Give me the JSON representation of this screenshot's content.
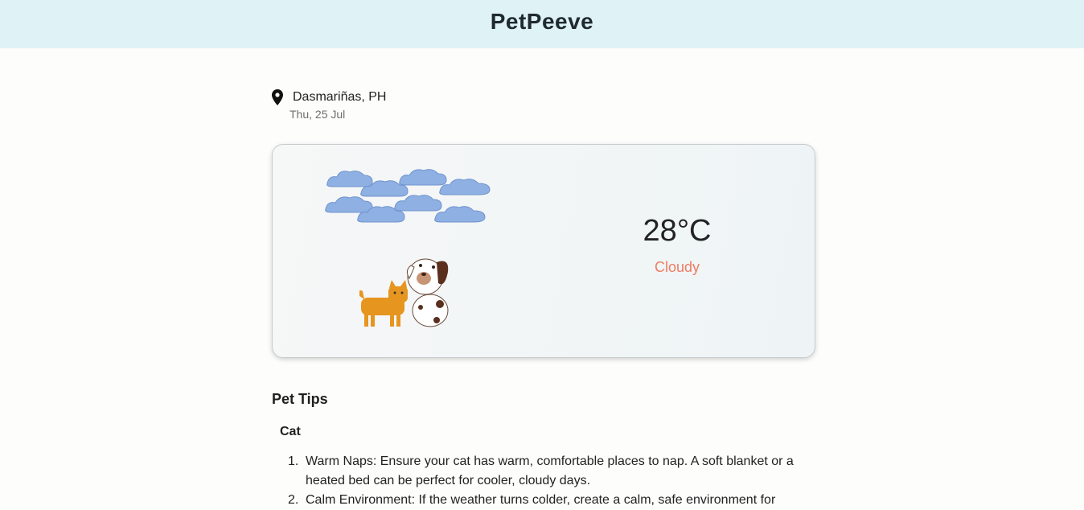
{
  "header": {
    "title": "PetPeeve"
  },
  "location": {
    "name": "Dasmariñas, PH",
    "date": "Thu, 25 Jul",
    "icon": "map-pin-icon"
  },
  "weather": {
    "temperature": "28°C",
    "condition": "Cloudy",
    "condition_color": "#ef7b63",
    "weather_icon": "clouds-icon",
    "pet_icon": "cat-and-dog-icon"
  },
  "tips": {
    "heading": "Pet Tips",
    "pet": "Cat",
    "items": [
      {
        "number": "1.",
        "text": "Warm Naps: Ensure your cat has warm, comfortable places to nap. A soft blanket or a heated bed can be perfect for cooler, cloudy days."
      },
      {
        "number": "2.",
        "text": "Calm Environment: If the weather turns colder, create a calm, safe environment for"
      }
    ]
  },
  "colors": {
    "header_bg": "#dff2f6",
    "accent": "#ef7b63"
  }
}
